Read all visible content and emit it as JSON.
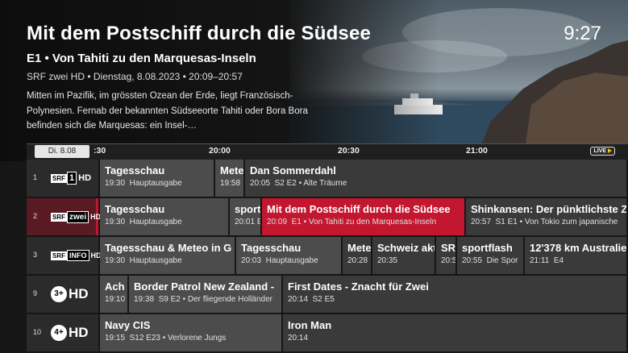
{
  "header": {
    "title": "Mit dem Postschiff durch die Südsee",
    "clock": "9:27",
    "episode": "E1  •  Von Tahiti zu den Marquesas-Inseln",
    "meta": "SRF zwei HD  •  Dienstag, 8.08.2023  •  20:09–20:57",
    "description": "Mitten im Pazifik, im grössten Ozean der Erde, liegt Französisch-Polynesien. Fernab der bekannten Südseeorte Tahiti oder Bora Bora befinden sich die Marquesas: ein Insel-…"
  },
  "timeline": {
    "date": "Di. 8.08",
    "ticks": [
      ":30",
      "20:00",
      "20:30",
      "21:00"
    ],
    "live": "LIVE"
  },
  "channels": [
    {
      "number": "1",
      "logo": {
        "box": "SRF",
        "box2": "1",
        "text": "HD"
      },
      "programs": [
        {
          "title": "Tagesschau",
          "time": "19:30",
          "sub": "Hauptausgabe"
        },
        {
          "title": "Mete",
          "time": "19:58",
          "sub": ""
        },
        {
          "title": "Dan Sommerdahl",
          "time": "20:05",
          "sub": "S2 E2 • Alte Träume"
        }
      ]
    },
    {
      "number": "2",
      "logo": {
        "box": "SRF",
        "box2": "zwei",
        "text": "HD"
      },
      "programs": [
        {
          "title": "Tagesschau",
          "time": "19:30",
          "sub": "Hauptausgabe"
        },
        {
          "title": "sport",
          "time": "20:01",
          "sub": "E"
        },
        {
          "title": "Mit dem Postschiff durch die Südsee",
          "time": "20:09",
          "sub": "E1 • Von Tahiti zu den Marquesas-Inseln"
        },
        {
          "title": "Shinkansen: Der pünktlichste Z",
          "time": "20:57",
          "sub": "S1 E1 • Von Tokio zum japanische"
        }
      ]
    },
    {
      "number": "3",
      "logo": {
        "box": "SRF",
        "box2": "INFO",
        "text": "HD"
      },
      "programs": [
        {
          "title": "Tagesschau & Meteo in G",
          "time": "19:30",
          "sub": "Hauptausgabe"
        },
        {
          "title": "Tagesschau",
          "time": "20:03",
          "sub": "Hauptausgabe"
        },
        {
          "title": "Mete",
          "time": "20:28",
          "sub": ""
        },
        {
          "title": "Schweiz akt",
          "time": "20:35",
          "sub": ""
        },
        {
          "title": "SRF",
          "time": "20:5",
          "sub": ""
        },
        {
          "title": "sportflash",
          "time": "20:55",
          "sub": "Die Spor"
        },
        {
          "title": "12'378 km Australie",
          "time": "21:11",
          "sub": "E4"
        }
      ]
    },
    {
      "number": "9",
      "logo": {
        "box": "3+",
        "box2": "",
        "text": "HD"
      },
      "programs": [
        {
          "title": "Ach",
          "time": "19:10",
          "sub": ""
        },
        {
          "title": "Border Patrol New Zealand -",
          "time": "19:38",
          "sub": "S9 E2 • Der fliegende Holländer"
        },
        {
          "title": "First Dates - Znacht für Zwei",
          "time": "20:14",
          "sub": "S2 E5"
        }
      ]
    },
    {
      "number": "10",
      "logo": {
        "box": "4+",
        "box2": "",
        "text": "HD"
      },
      "programs": [
        {
          "title": "Navy CIS",
          "time": "19:15",
          "sub": "S12 E23 • Verlorene Jungs"
        },
        {
          "title": "Iron Man",
          "time": "20:14",
          "sub": ""
        }
      ]
    }
  ]
}
